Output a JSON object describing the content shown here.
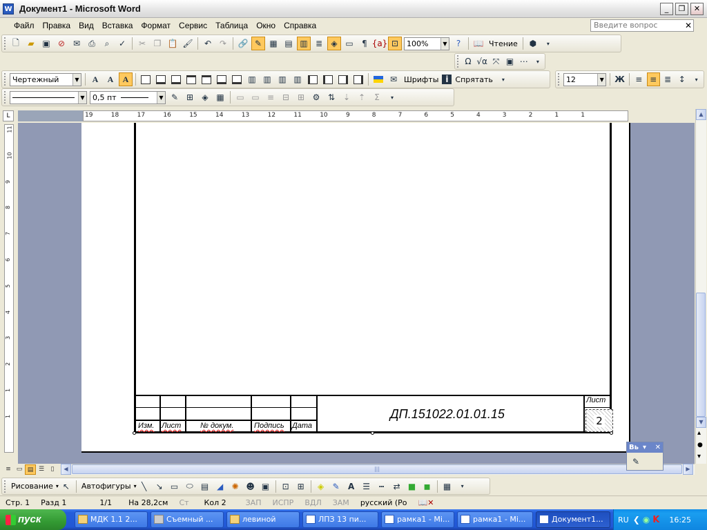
{
  "window": {
    "title": "Документ1 - Microsoft Word",
    "app_icon": "W"
  },
  "menu": {
    "items": [
      "Файл",
      "Правка",
      "Вид",
      "Вставка",
      "Формат",
      "Сервис",
      "Таблица",
      "Окно",
      "Справка"
    ],
    "help_placeholder": "Введите вопрос"
  },
  "toolbar_standard": {
    "zoom": "100%",
    "reading_label": "Чтение"
  },
  "toolbar_format": {
    "font_name": "Чертежный",
    "font_size": "12",
    "fonts_label": "Шрифты",
    "hide_label": "Спрятать",
    "bold_glyph": "Ж"
  },
  "toolbar_borders": {
    "line_width": "0,5 пт"
  },
  "ruler": {
    "h_labels": [
      "19",
      "18",
      "17",
      "16",
      "15",
      "14",
      "13",
      "12",
      "11",
      "10",
      "9",
      "8",
      "7",
      "6",
      "5",
      "4",
      "3",
      "2",
      "1",
      "1"
    ],
    "v_labels": [
      "11",
      "10",
      "9",
      "8",
      "7",
      "6",
      "5",
      "4",
      "3",
      "2",
      "1",
      "1"
    ]
  },
  "stamp": {
    "labels": [
      "Изм.",
      "Лист",
      "№ докум.",
      "Подпись",
      "Дата"
    ],
    "code": "ДП.151022.01.01.15",
    "sheet_label": "Лист",
    "sheet_number": "2"
  },
  "drawing_toolbar": {
    "draw_label": "Рисование",
    "autoshapes_label": "Автофигуры"
  },
  "floating_toolbar": {
    "label": "Вь"
  },
  "status": {
    "page": "Стр. 1",
    "section": "Разд 1",
    "pages": "1/1",
    "at": "На 28,2см",
    "line": "Ст",
    "col": "Кол 2",
    "rec": "ЗАП",
    "trk": "ИСПР",
    "ext": "ВДЛ",
    "ovr": "ЗАМ",
    "lang": "русский (Ро"
  },
  "taskbar": {
    "start_label": "пуск",
    "tasks": [
      "МДК 1.1 2...",
      "Съемный ...",
      "левиной",
      "ЛПЗ 13 пи...",
      "рамка1 - Mi...",
      "рамка1 - Mi...",
      "Документ1..."
    ],
    "lang": "RU",
    "time": "16:25"
  }
}
